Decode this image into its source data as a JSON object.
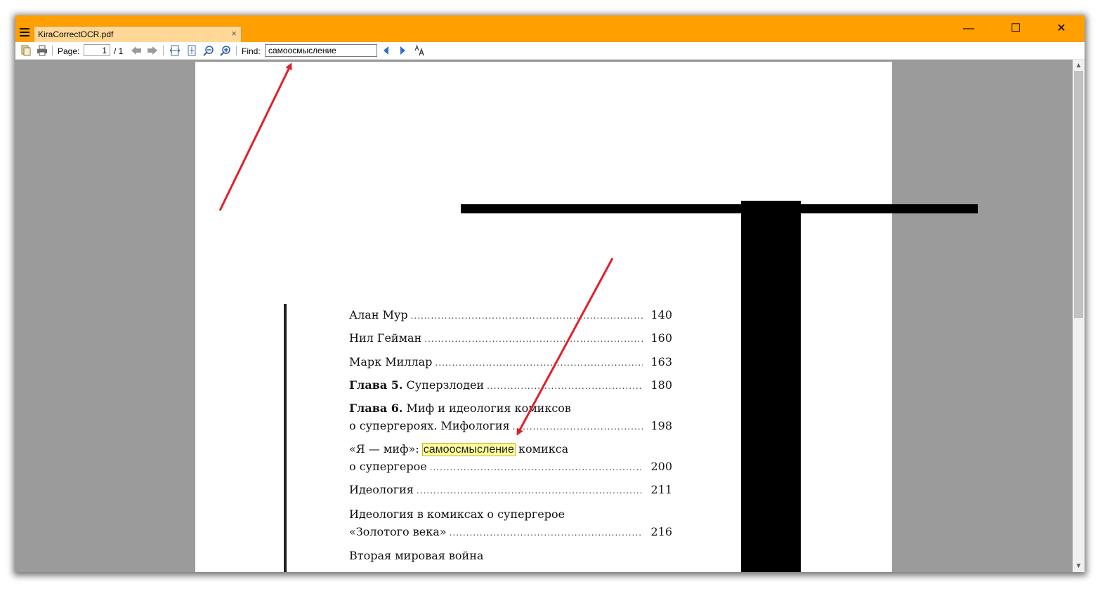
{
  "window": {
    "tab_title": "KiraCorrectOCR.pdf",
    "tab_close": "×",
    "minimize": "—",
    "maximize": "☐",
    "close": "✕"
  },
  "toolbar": {
    "page_label": "Page:",
    "page_value": "1",
    "page_total": "/ 1",
    "find_label": "Find:",
    "find_value": "самоосмысление",
    "icons": [
      "open-icon",
      "print-icon",
      "prev-page-icon",
      "next-page-icon",
      "fit-width-icon",
      "fit-page-icon",
      "zoom-out-icon",
      "zoom-in-icon",
      "find-prev-icon",
      "find-next-icon",
      "match-case-icon"
    ]
  },
  "document": {
    "toc": [
      {
        "text": "Алан Мур",
        "page": "140"
      },
      {
        "text": "Нил Гейман",
        "page": "160"
      },
      {
        "text": "Марк Миллар",
        "page": "163"
      },
      {
        "bold": "Глава 5.",
        "text": " Суперзлодеи",
        "page": "180"
      },
      {
        "bold": "Глава 6.",
        "text": " Миф и идеология комиксов"
      },
      {
        "text": "о супергероях. Мифология",
        "page": "198"
      },
      {
        "before": "«Я — миф»: ",
        "highlight": "самоосмысление",
        "after": " комикса"
      },
      {
        "text": "о супергерое",
        "page": "200"
      },
      {
        "text": "Идеология",
        "page": "211"
      },
      {
        "text": "Идеология в комиксах о супергерое"
      },
      {
        "text": "«Золотого века»",
        "page": "216"
      },
      {
        "text": "Вторая мировая война"
      }
    ],
    "dots": "......................................................................................................................................................"
  },
  "scrollbar": {
    "up": "▲",
    "down": "▼"
  },
  "colors": {
    "accent": "#ff9f00",
    "tab": "#ffd898",
    "highlight": "#ffff9c",
    "annotation_arrow": "#e0202a"
  }
}
